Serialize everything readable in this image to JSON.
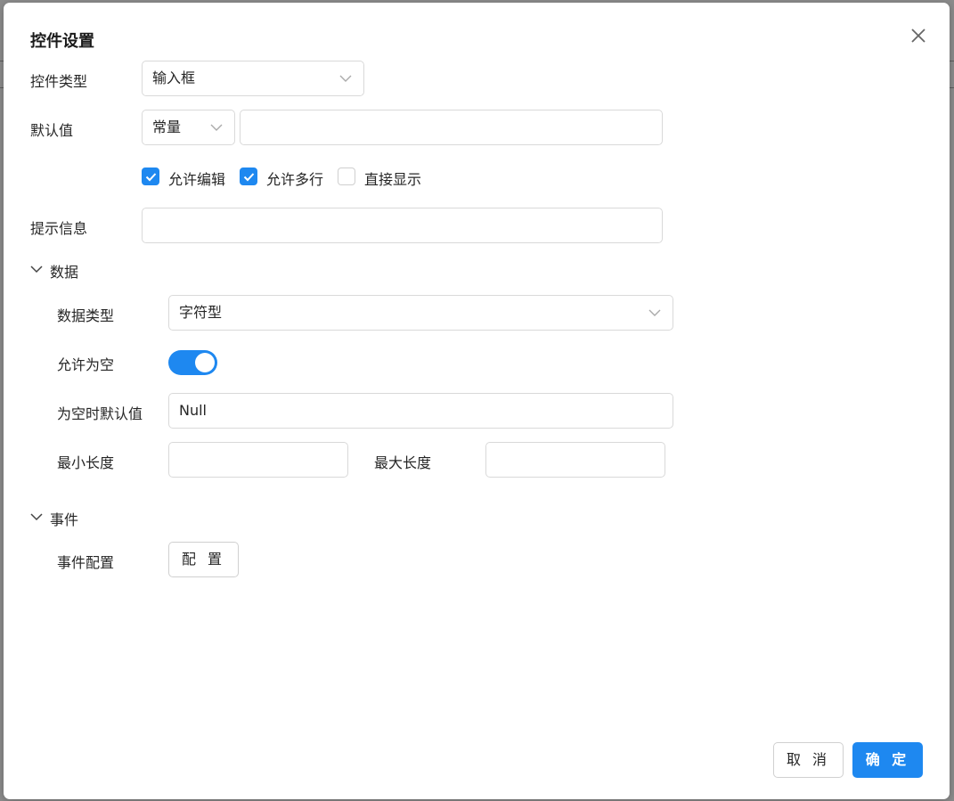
{
  "dialog": {
    "title": "控件设置",
    "close_icon": "close-icon"
  },
  "form": {
    "control_type": {
      "label": "控件类型",
      "value": "输入框"
    },
    "default_value": {
      "label": "默认值",
      "mode": "常量",
      "value": ""
    },
    "checkboxes": [
      {
        "label": "允许编辑",
        "checked": true
      },
      {
        "label": "允许多行",
        "checked": true
      },
      {
        "label": "直接显示",
        "checked": false
      }
    ],
    "hint": {
      "label": "提示信息",
      "value": ""
    }
  },
  "data_section": {
    "title": "数据",
    "data_type": {
      "label": "数据类型",
      "value": "字符型"
    },
    "allow_empty": {
      "label": "允许为空",
      "on": true
    },
    "empty_default": {
      "label": "为空时默认值",
      "value": "Null"
    },
    "min_length": {
      "label": "最小长度",
      "value": ""
    },
    "max_length": {
      "label": "最大长度",
      "value": ""
    }
  },
  "event_section": {
    "title": "事件",
    "config": {
      "label": "事件配置",
      "button": "配 置"
    }
  },
  "footer": {
    "cancel": "取 消",
    "ok": "确 定"
  },
  "colors": {
    "primary": "#1e88f0",
    "border": "#d9d9d9"
  }
}
